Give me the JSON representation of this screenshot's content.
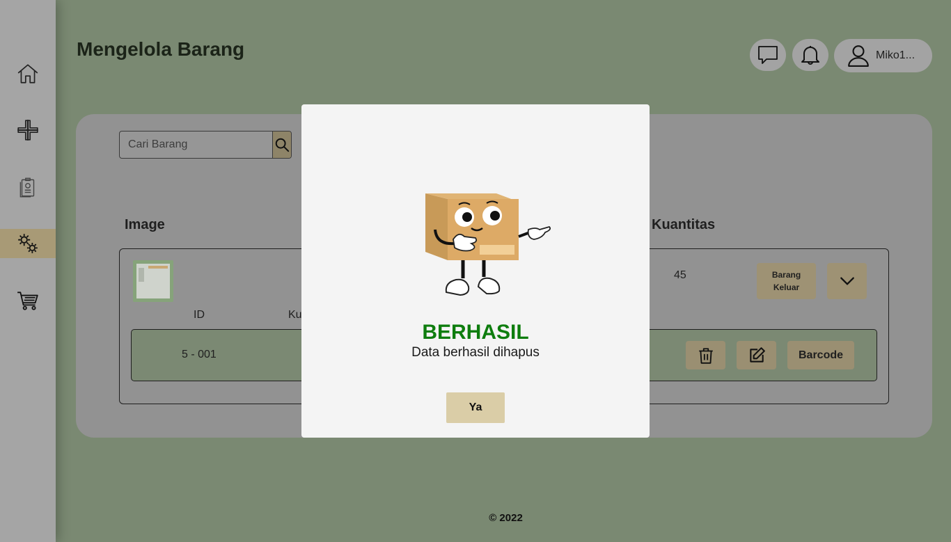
{
  "header": {
    "title": "Mengelola Barang",
    "user_name": "Miko1..."
  },
  "sidebar": {
    "items": [
      {
        "name": "home",
        "icon": "home-icon"
      },
      {
        "name": "add",
        "icon": "plus-icon"
      },
      {
        "name": "report",
        "icon": "report-icon"
      },
      {
        "name": "manage",
        "icon": "gears-icon",
        "active": true
      },
      {
        "name": "cart",
        "icon": "cart-icon"
      }
    ]
  },
  "search": {
    "placeholder": "Cari Barang"
  },
  "table": {
    "columns": {
      "image": "Image",
      "quantity": "Kuantitas"
    },
    "item": {
      "quantity": "45",
      "keluar_label": "Barang Keluar",
      "sub_columns": {
        "id": "ID",
        "second": "Ku"
      },
      "detail": {
        "id": "5 - 001",
        "barcode_label": "Barcode"
      }
    }
  },
  "footer": {
    "copyright": "© 2022"
  },
  "modal": {
    "title": "BERHASIL",
    "message": "Data berhasil dihapus",
    "ok_label": "Ya"
  },
  "colors": {
    "background": "#7a8972",
    "sidebar": "#a5a5a5",
    "accent": "#dacda7",
    "success": "#0e7d0e"
  }
}
